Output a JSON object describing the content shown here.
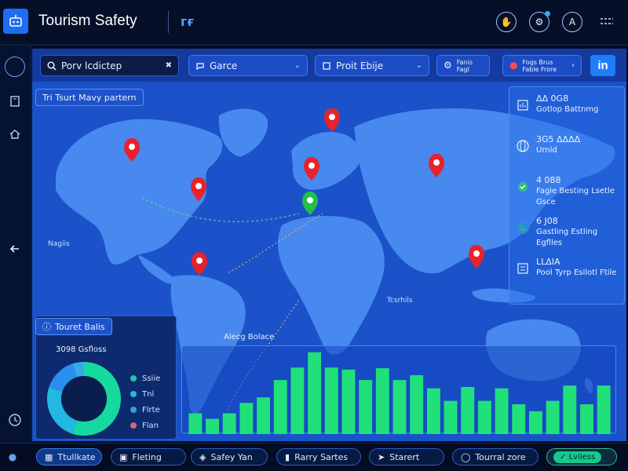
{
  "header": {
    "title": "Tourism Safety",
    "brand_glyph": "гғ",
    "buttons": [
      {
        "icon": "hand-icon",
        "label": "✋"
      },
      {
        "icon": "settings-icon",
        "label": "⚙"
      },
      {
        "icon": "account-icon",
        "label": "A"
      }
    ]
  },
  "toolbar": {
    "search_value": "Porv lcdictep",
    "search_clear": "✖",
    "dropdown1_label": "Garce",
    "dropdown2_label": "Proit Ebije",
    "filter_line1": "Fanis",
    "filter_line2": "Fagl",
    "location_line1": "Fogs Brus",
    "location_line2": "Fable Frore",
    "linkedin_label": "in"
  },
  "map": {
    "chip_label": "Tri Tsurt Mavy partern",
    "label_north_atlantic": "Tcsrhils",
    "label_left_ocean": "Nagiis",
    "label_south": "Alecg Bolace",
    "pin_colors": {
      "red": "#e8222a",
      "green": "#22c04a"
    }
  },
  "stats": [
    {
      "icon": "chart-icon",
      "value": "ΔΔ 0G8",
      "label": "Gotlop Battnmg"
    },
    {
      "icon": "globe-icon",
      "value": "3G5 ΔΔΔΔ",
      "label": "Urnld"
    },
    {
      "icon": "check-icon",
      "value": "4 088",
      "label": "Fagie Besting Lsetle Gsce"
    },
    {
      "icon": "earth-icon",
      "value": "6 J08",
      "label": "Gastling Estling Egflles"
    },
    {
      "icon": "list-icon",
      "value": "LLΔIA",
      "label": "Pool Tyrp Esilotl Ftile"
    }
  ],
  "donut": {
    "chip_label": "Touret Balis",
    "subtitle": "3098 Gsfloss",
    "legend": [
      {
        "label": "Ssiie",
        "color": "#22c3a8"
      },
      {
        "label": "Tnl",
        "color": "#2bb7e8"
      },
      {
        "label": "Flrte",
        "color": "#3a9be8"
      },
      {
        "label": "Flan",
        "color": "#c46a82"
      }
    ],
    "slices": [
      0.55,
      0.25,
      0.15,
      0.05
    ]
  },
  "chart_data": {
    "type": "bar",
    "title": "",
    "xlabel": "",
    "ylabel": "",
    "values": [
      30,
      22,
      30,
      45,
      53,
      78,
      96,
      118,
      96,
      93,
      78,
      95,
      78,
      85,
      66,
      48,
      68,
      48,
      66,
      43,
      33,
      48,
      70,
      43,
      70
    ],
    "ylim": [
      0,
      120
    ]
  },
  "bottom_nav": [
    {
      "icon": "map-icon",
      "label": "Ttullkate"
    },
    {
      "icon": "folder-icon",
      "label": "Fleting"
    },
    {
      "icon": "shield-icon",
      "label": "Safey Yan"
    },
    {
      "icon": "bookmark-icon",
      "label": "Rarry Sartes"
    },
    {
      "icon": "compass-icon",
      "label": "Starert"
    },
    {
      "icon": "globe-icon",
      "label": "Tourral zore"
    },
    {
      "icon": "check-circle-icon",
      "label": "Lviless"
    }
  ]
}
